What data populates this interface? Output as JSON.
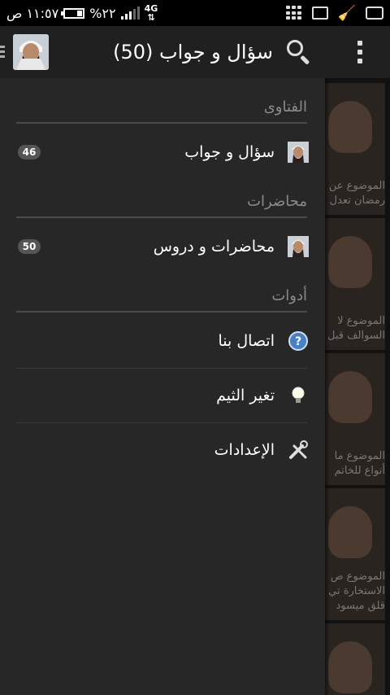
{
  "status_bar": {
    "time": "١١:٥٧ ص",
    "battery": "%٢٢",
    "network": "4G"
  },
  "action_bar": {
    "title": "سؤال و جواب (50)",
    "icons": [
      "overflow-menu-icon",
      "search-icon",
      "avatar"
    ]
  },
  "drawer": {
    "sections": [
      {
        "title": "الفتاوى",
        "items": [
          {
            "label": "سؤال و جواب",
            "badge": "46",
            "icon": "sheikh-avatar-icon"
          }
        ]
      },
      {
        "title": "محاضرات",
        "items": [
          {
            "label": "محاضرات و دروس",
            "badge": "50",
            "icon": "sheikh-avatar-icon"
          }
        ]
      },
      {
        "title": "أدوات",
        "items": [
          {
            "label": "اتصال بنا",
            "icon": "help-icon"
          },
          {
            "label": "تغير الثيم",
            "icon": "lightbulb-icon"
          },
          {
            "label": "الإعدادات",
            "icon": "tools-icon"
          }
        ]
      }
    ]
  },
  "background_list": [
    {
      "caption_1": "الموضوع عن",
      "caption_2": "رمضان تعدل"
    },
    {
      "caption_1": "الموضوع لا",
      "caption_2": "السوالف قبل"
    },
    {
      "caption_1": "الموضوع ما",
      "caption_2": "أنواع للخاتم"
    },
    {
      "caption_1": "الموضوع ص",
      "caption_2": "الاستخارة تي"
    },
    {
      "caption_1": "",
      "caption_2": ""
    }
  ],
  "extra_background_text": "قلق ميسود"
}
